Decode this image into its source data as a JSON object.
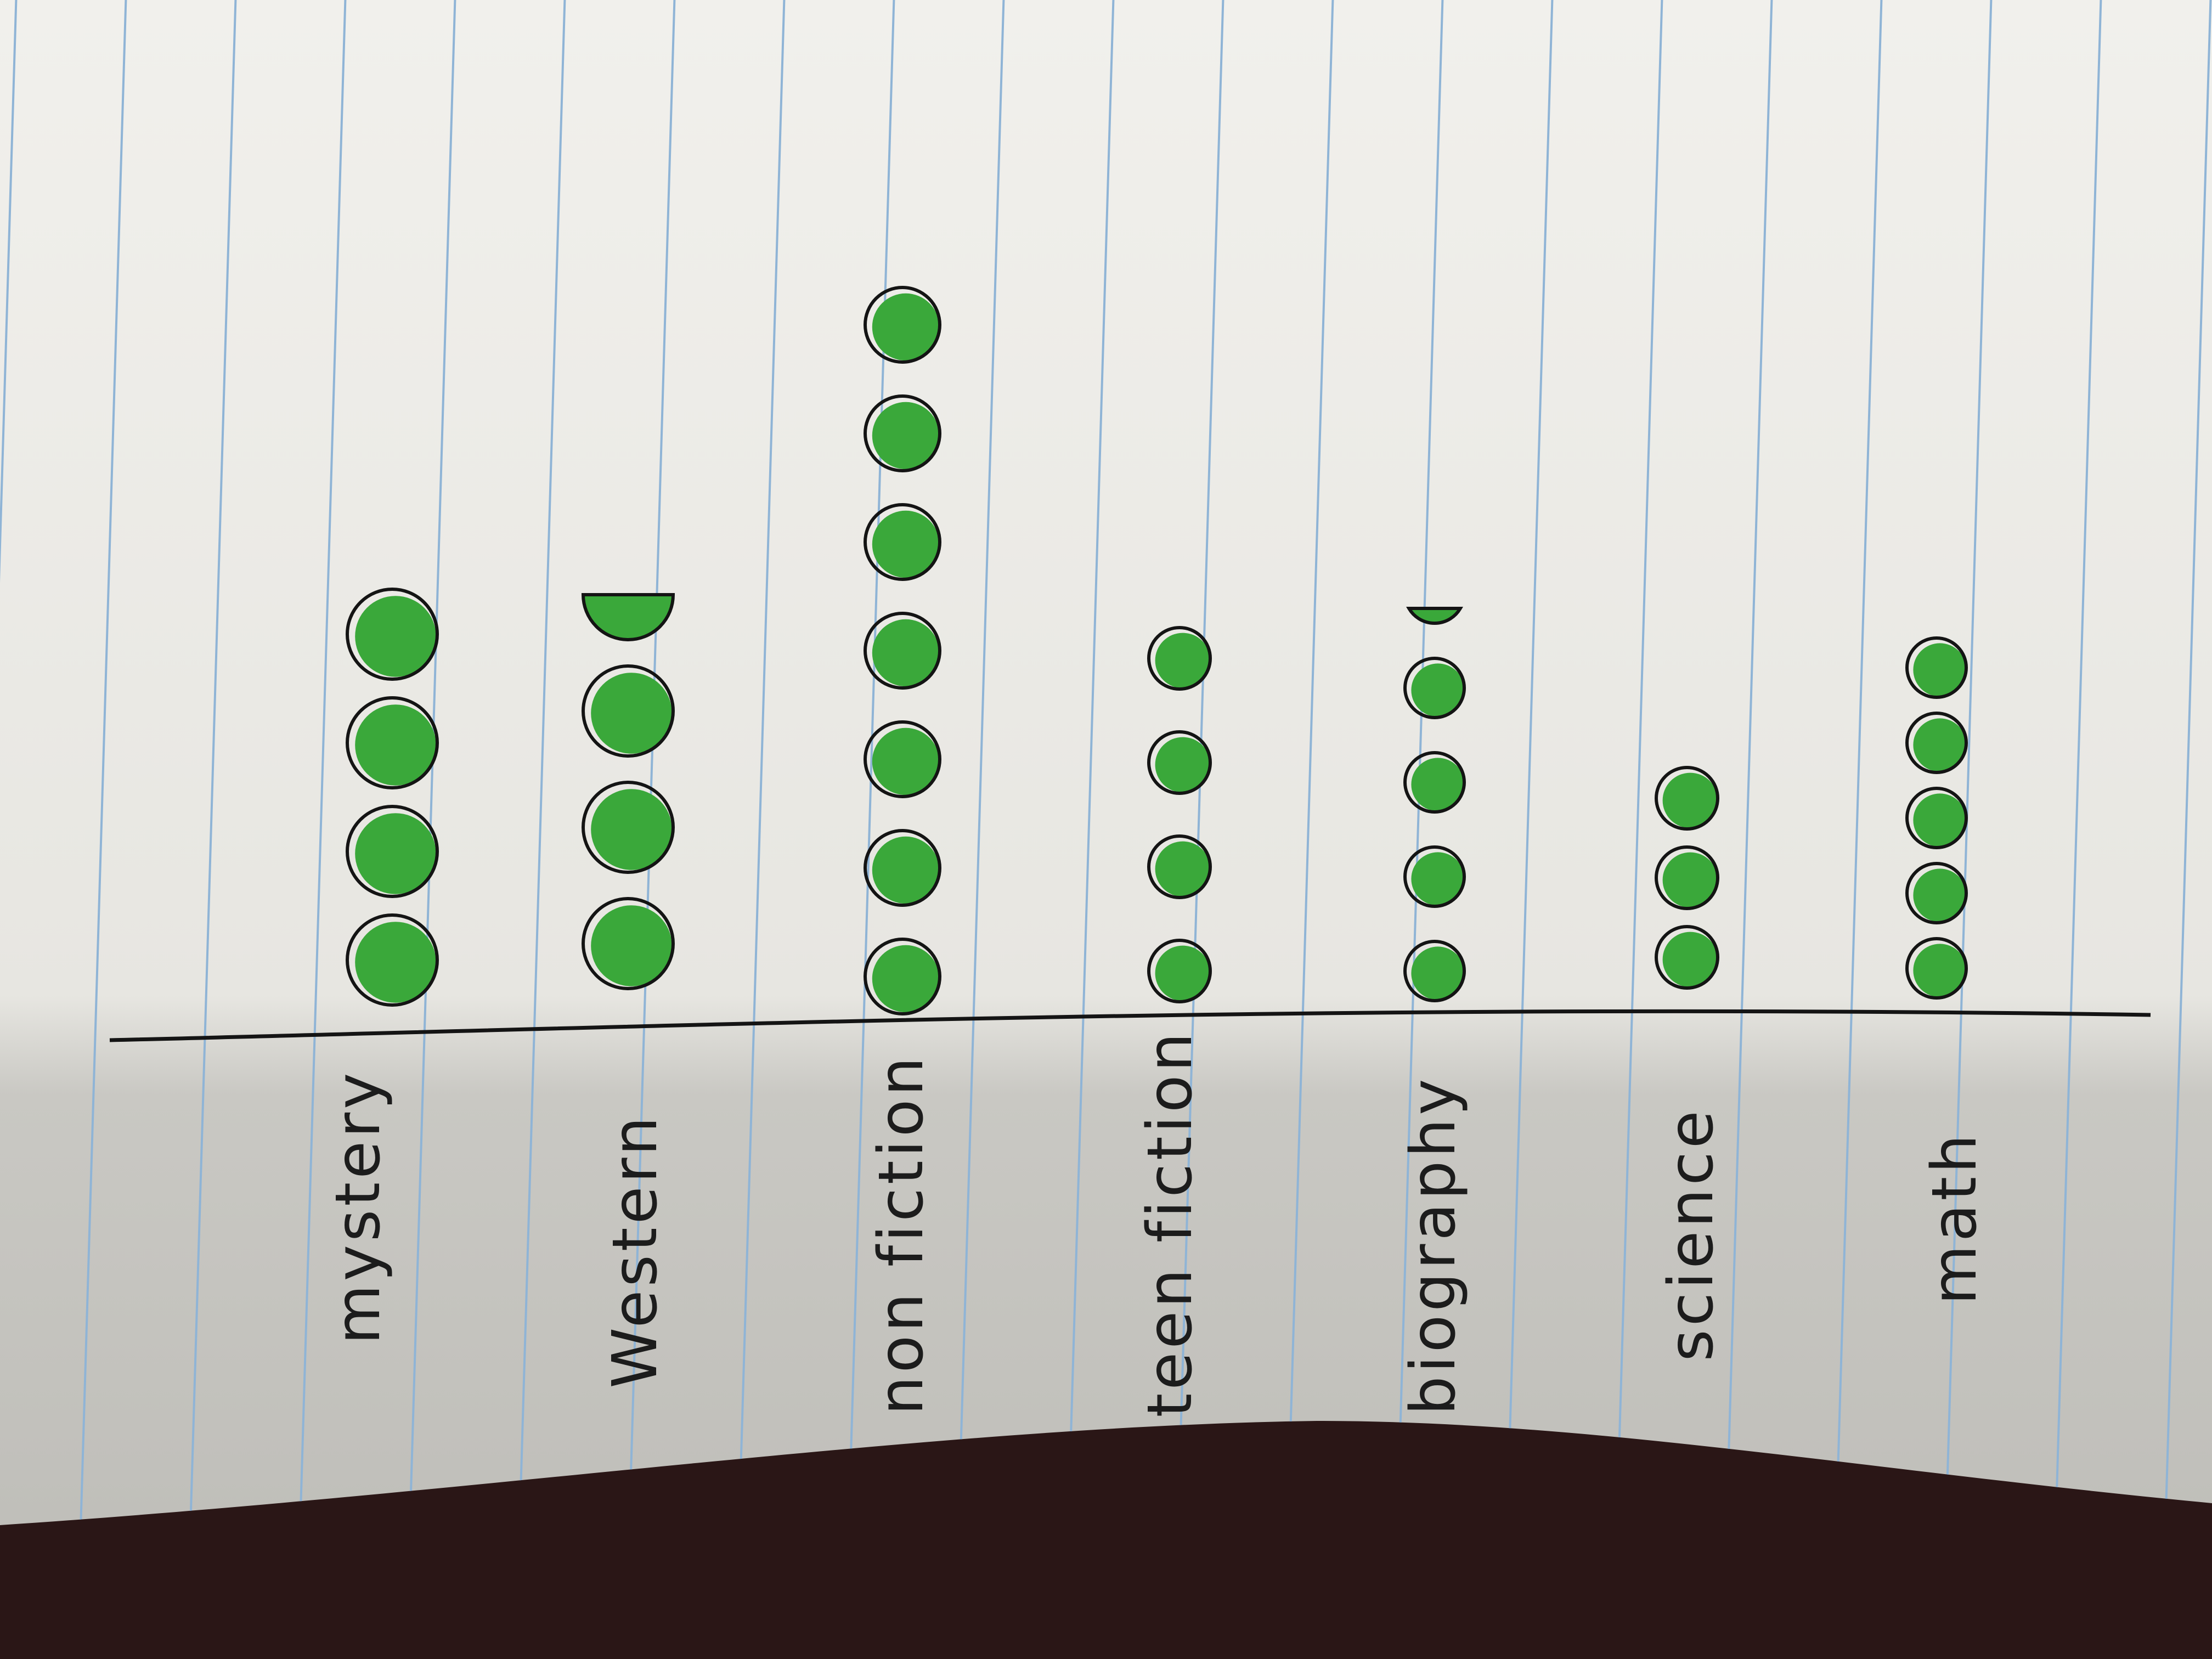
{
  "chart_data": {
    "type": "pictograph",
    "orientation": "vertical",
    "categories": [
      "mystery",
      "Western",
      "non fiction",
      "teen fiction",
      "biography",
      "science",
      "math"
    ],
    "values": [
      4,
      3.5,
      7,
      4,
      4.25,
      3,
      5
    ],
    "title": "",
    "xlabel": "",
    "ylabel": "",
    "symbol": "green dot",
    "colors": {
      "symbol_fill": "#3aa83a",
      "symbol_outline": "#141414",
      "paper": "#ecebe6",
      "rule_lines": "#8fb4d6",
      "table": "#2a1616"
    }
  }
}
